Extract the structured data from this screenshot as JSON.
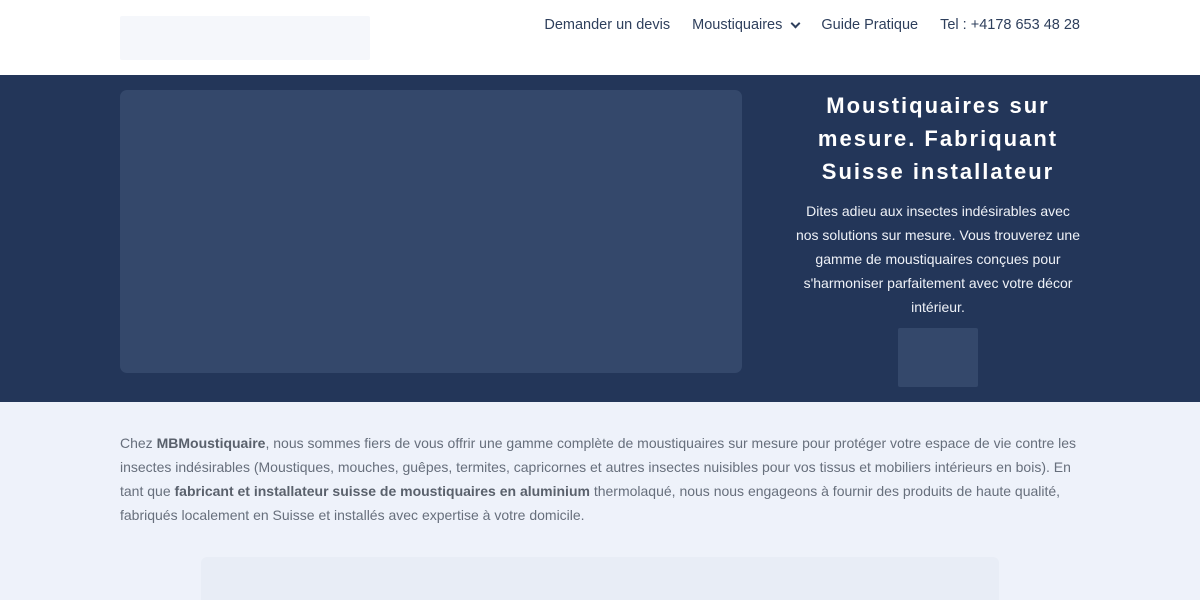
{
  "header": {
    "nav": [
      {
        "label": "Demander un devis"
      },
      {
        "label": "Moustiquaires",
        "has_dropdown": true
      },
      {
        "label": "Guide Pratique"
      },
      {
        "label": "Tel : +4178 653 48 28"
      }
    ]
  },
  "hero": {
    "title": "Moustiquaires sur mesure. Fabriquant Suisse installateur",
    "description": "Dites adieu aux insectes indésirables avec nos solutions sur mesure. Vous trouverez une gamme de moustiquaires conçues pour s'harmoniser parfaitement avec votre décor intérieur."
  },
  "intro": {
    "p1": "Chez ",
    "brand": "MBMoustiquaire",
    "p2": ", nous sommes fiers de vous offrir une gamme complète de moustiquaires sur mesure pour protéger votre espace de vie contre les insectes indésirables (Moustiques, mouches, guêpes, termites, capricornes et autres insectes nuisibles pour vos tissus et mobiliers intérieurs en bois). En tant que ",
    "emphasis": "fabricant et installateur suisse de moustiquaires en aluminium",
    "p3": " thermolaqué, nous nous engageons à fournir des produits de haute qualité, fabriqués localement en Suisse et installés avec expertise à votre domicile."
  },
  "colors": {
    "hero_bg": "#233659",
    "placeholder": "#34486b",
    "page_bg": "#eef2fa",
    "nav_text": "#2e3f5c"
  }
}
